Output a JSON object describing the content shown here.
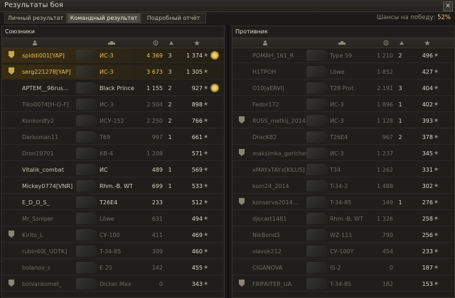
{
  "window": {
    "title": "Результаты боя",
    "close_label": "✕"
  },
  "tabs": [
    {
      "label": "Личный результат",
      "active": false
    },
    {
      "label": "Командный результат",
      "active": true
    },
    {
      "label": "Подробный отчёт",
      "active": false
    }
  ],
  "win_chance": {
    "label": "Шансы на победу:",
    "value": "52%"
  },
  "allies": {
    "title": "Союзники",
    "rows": [
      {
        "player": "spiddi001[YAP]",
        "tank": "ИС-3",
        "damage": "4 369",
        "kills": "3",
        "xp": "1 374",
        "badge": true,
        "award": true,
        "me": true,
        "dead": false
      },
      {
        "player": "serg221278[YAP]",
        "tank": "ИС-3",
        "damage": "3 673",
        "kills": "3",
        "xp": "1 305",
        "badge": true,
        "award": false,
        "me": true,
        "dead": false
      },
      {
        "player": "АРТЕМ__96rus...",
        "tank": "Black Prince",
        "damage": "1 155",
        "kills": "2",
        "xp": "927",
        "badge": false,
        "award": true,
        "me": false,
        "dead": false
      },
      {
        "player": "Tiko0074[H-Q-F]",
        "tank": "ИС-3",
        "damage": "2 504",
        "kills": "2",
        "xp": "898",
        "badge": false,
        "award": false,
        "me": false,
        "dead": true
      },
      {
        "player": "Konkordfy2",
        "tank": "ИСУ-152",
        "damage": "2 250",
        "kills": "2",
        "xp": "766",
        "badge": false,
        "award": false,
        "me": false,
        "dead": true
      },
      {
        "player": "Darksman11",
        "tank": "T69",
        "damage": "997",
        "kills": "1",
        "xp": "661",
        "badge": false,
        "award": false,
        "me": false,
        "dead": true
      },
      {
        "player": "Dron19701",
        "tank": "КВ-4",
        "damage": "1 208",
        "kills": "",
        "xp": "571",
        "badge": false,
        "award": false,
        "me": false,
        "dead": true
      },
      {
        "player": "Vitalik_combat",
        "tank": "ИС",
        "damage": "489",
        "kills": "1",
        "xp": "569",
        "badge": false,
        "award": false,
        "me": false,
        "dead": false
      },
      {
        "player": "Mickey0774[VNR]",
        "tank": "Rhm.-B. WT",
        "damage": "699",
        "kills": "1",
        "xp": "533",
        "badge": false,
        "award": false,
        "me": false,
        "dead": false
      },
      {
        "player": "E_D_O_S_",
        "tank": "T26E4",
        "damage": "233",
        "kills": "",
        "xp": "512",
        "badge": false,
        "award": false,
        "me": false,
        "dead": false
      },
      {
        "player": "Mr_Ssniper",
        "tank": "Löwe",
        "damage": "631",
        "kills": "",
        "xp": "494",
        "badge": false,
        "award": false,
        "me": false,
        "dead": true
      },
      {
        "player": "Kirito_L",
        "tank": "СУ-100",
        "damage": "411",
        "kills": "",
        "xp": "469",
        "badge": true,
        "award": false,
        "me": false,
        "dead": true
      },
      {
        "player": "rubin60[_UDTK]",
        "tank": "T-34-85",
        "damage": "309",
        "kills": "",
        "xp": "460",
        "badge": false,
        "award": false,
        "me": false,
        "dead": true
      },
      {
        "player": "bolanov_s",
        "tank": "E 25",
        "damage": "142",
        "kills": "",
        "xp": "455",
        "badge": false,
        "award": false,
        "me": false,
        "dead": true
      },
      {
        "player": "bolvankomet_",
        "tank": "Dicker Max",
        "damage": "0",
        "kills": "",
        "xp": "343",
        "badge": true,
        "award": false,
        "me": false,
        "dead": true
      }
    ]
  },
  "enemies": {
    "title": "Противник",
    "rows": [
      {
        "player": "POMAH_161_R",
        "tank": "Type 59",
        "damage": "1 210",
        "kills": "2",
        "xp": "496",
        "badge": false,
        "award": false,
        "me": false,
        "dead": true
      },
      {
        "player": "H1TPOH",
        "tank": "Löwe",
        "damage": "1 852",
        "kills": "",
        "xp": "427",
        "badge": false,
        "award": false,
        "me": false,
        "dead": true
      },
      {
        "player": "O10|aERVI|",
        "tank": "T28 Prot.",
        "damage": "2 191",
        "kills": "3",
        "xp": "404",
        "badge": false,
        "award": false,
        "me": false,
        "dead": true
      },
      {
        "player": "Fedor172",
        "tank": "ИС-3",
        "damage": "1 896",
        "kills": "1",
        "xp": "402",
        "badge": false,
        "award": false,
        "me": false,
        "dead": true
      },
      {
        "player": "RUSS_metkij_2014...",
        "tank": "ИС-3",
        "damage": "1 128",
        "kills": "1",
        "xp": "393",
        "badge": true,
        "award": false,
        "me": false,
        "dead": true
      },
      {
        "player": "DracK82",
        "tank": "T26E4",
        "damage": "967",
        "kills": "2",
        "xp": "378",
        "badge": false,
        "award": false,
        "me": false,
        "dead": true
      },
      {
        "player": "maksimka_gorichev...",
        "tank": "ИС-3",
        "damage": "1 237",
        "kills": "",
        "xp": "345",
        "badge": true,
        "award": false,
        "me": false,
        "dead": true
      },
      {
        "player": "xMAYxTAYx[KILUS]",
        "tank": "T34",
        "damage": "1 262",
        "kills": "",
        "xp": "331",
        "badge": false,
        "award": false,
        "me": false,
        "dead": true
      },
      {
        "player": "kom24_2014",
        "tank": "T-34-2",
        "damage": "1 488",
        "kills": "",
        "xp": "302",
        "badge": false,
        "award": false,
        "me": false,
        "dead": true
      },
      {
        "player": "konserva2014...",
        "tank": "T-34-85",
        "damage": "149",
        "kills": "1",
        "xp": "276",
        "badge": true,
        "award": false,
        "me": false,
        "dead": true
      },
      {
        "player": "djocart1481",
        "tank": "Rhm.-B. WT",
        "damage": "1 326",
        "kills": "",
        "xp": "258",
        "badge": false,
        "award": false,
        "me": false,
        "dead": true
      },
      {
        "player": "NikBond3",
        "tank": "WZ-111",
        "damage": "790",
        "kills": "",
        "xp": "256",
        "badge": false,
        "award": false,
        "me": false,
        "dead": true
      },
      {
        "player": "slavok212",
        "tank": "СУ-100Y",
        "damage": "454",
        "kills": "",
        "xp": "233",
        "badge": false,
        "award": false,
        "me": false,
        "dead": true
      },
      {
        "player": "CIGANOVA",
        "tank": "IS-2",
        "damage": "0",
        "kills": "",
        "xp": "187",
        "badge": false,
        "award": false,
        "me": false,
        "dead": true
      },
      {
        "player": "FRIFAITER_UA",
        "tank": "T-34-85",
        "damage": "182",
        "kills": "",
        "xp": "153",
        "badge": true,
        "award": false,
        "me": false,
        "dead": true
      }
    ]
  }
}
